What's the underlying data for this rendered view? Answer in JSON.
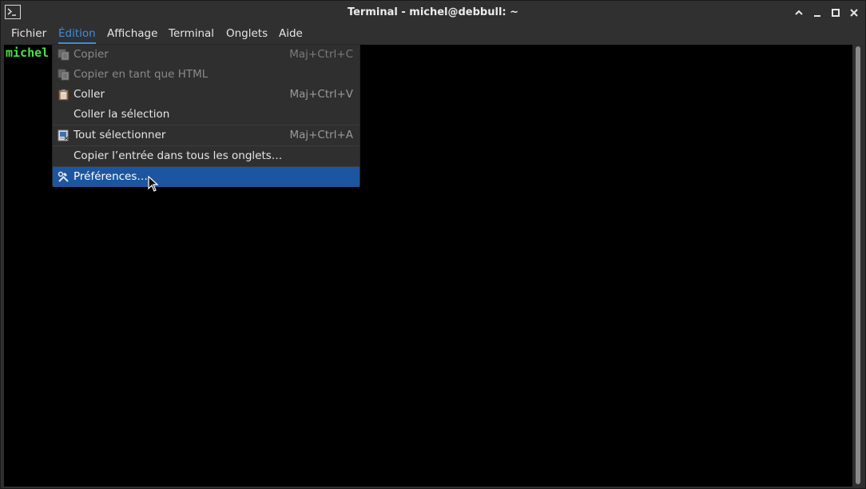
{
  "window": {
    "title": "Terminal - michel@debbull: ~"
  },
  "menubar": {
    "items": [
      {
        "label": "Fichier"
      },
      {
        "label": "Édition"
      },
      {
        "label": "Affichage"
      },
      {
        "label": "Terminal"
      },
      {
        "label": "Onglets"
      },
      {
        "label": "Aide"
      }
    ],
    "active_index": 1
  },
  "terminal": {
    "prompt_text": "michel"
  },
  "edit_menu": {
    "items": [
      {
        "label": "Copier",
        "shortcut": "Maj+Ctrl+C",
        "icon": "copy-icon",
        "enabled": false
      },
      {
        "label": "Copier en tant que HTML",
        "shortcut": "",
        "icon": "copy-html-icon",
        "enabled": false
      },
      {
        "label": "Coller",
        "shortcut": "Maj+Ctrl+V",
        "icon": "paste-icon",
        "enabled": true
      },
      {
        "label": "Coller la sélection",
        "shortcut": "",
        "icon": "",
        "enabled": true
      },
      {
        "label": "Tout sélectionner",
        "shortcut": "Maj+Ctrl+A",
        "icon": "select-all-icon",
        "enabled": true
      },
      {
        "label": "Copier l’entrée dans tous les onglets…",
        "shortcut": "",
        "icon": "",
        "enabled": true
      },
      {
        "label": "Préférences…",
        "shortcut": "",
        "icon": "tools-icon",
        "enabled": true,
        "highlighted": true
      }
    ]
  },
  "colors": {
    "accent": "#3c8ee0",
    "highlight": "#1c56a0",
    "prompt": "#4be04b",
    "terminal_bg": "#000000",
    "chrome_bg": "#303030"
  }
}
